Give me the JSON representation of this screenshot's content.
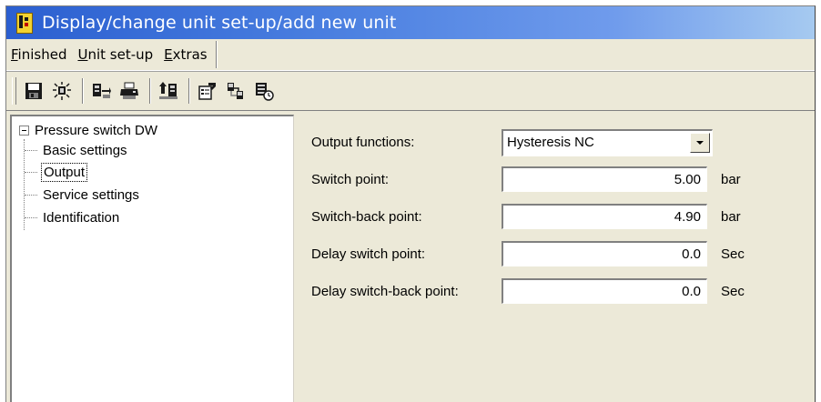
{
  "window": {
    "title": "Display/change unit set-up/add new unit"
  },
  "menu": [
    {
      "label": "Finished",
      "acc": "F",
      "rest": "inished"
    },
    {
      "label": "Unit set-up",
      "acc": "U",
      "rest": "nit set-up"
    },
    {
      "label": "Extras",
      "acc": "E",
      "rest": "xtras"
    }
  ],
  "toolbar": {
    "icons": [
      "save-icon",
      "transmit-icon",
      "download-icon",
      "print-icon",
      "upload-icon",
      "properties-icon",
      "connect-icon",
      "monitor-icon"
    ]
  },
  "tree": {
    "root": "Pressure switch DW",
    "children": [
      "Basic settings",
      "Output",
      "Service settings",
      "Identification"
    ],
    "selected": "Output"
  },
  "form": {
    "output_functions": {
      "label": "Output functions:",
      "value": "Hysteresis NC"
    },
    "switch_point": {
      "label": "Switch point:",
      "value": "5.00",
      "unit": "bar"
    },
    "switch_back_point": {
      "label": "Switch-back point:",
      "value": "4.90",
      "unit": "bar"
    },
    "delay_switch_point": {
      "label": "Delay switch point:",
      "value": "0.0",
      "unit": "Sec"
    },
    "delay_switch_back_point": {
      "label": "Delay switch-back point:",
      "value": "0.0",
      "unit": "Sec"
    }
  },
  "colors": {
    "title_start": "#2b5fd0",
    "title_end": "#a6caf0",
    "face": "#ece9d8"
  }
}
